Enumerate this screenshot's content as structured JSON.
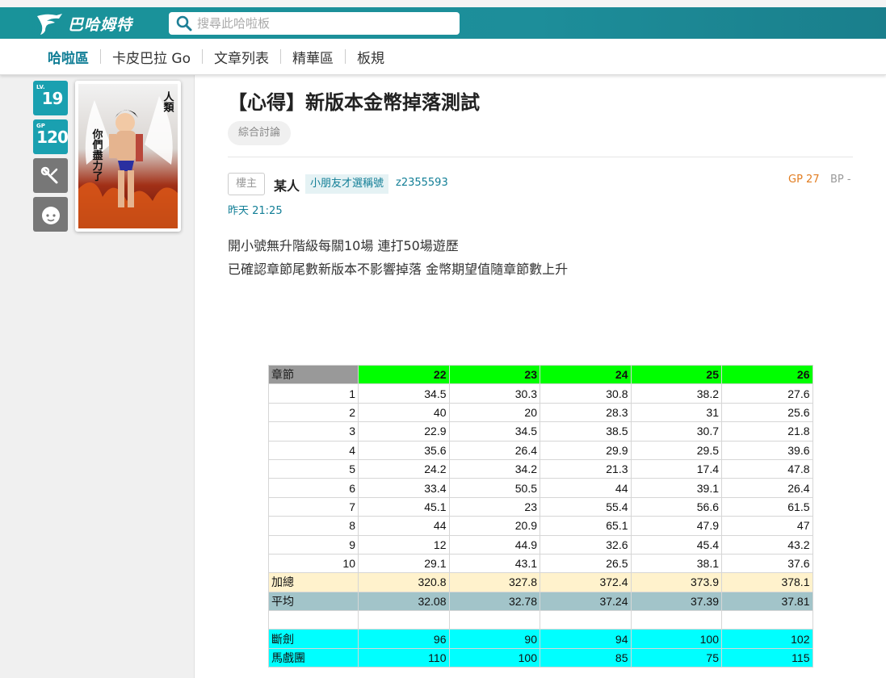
{
  "site": {
    "logo_text": "巴哈姆特"
  },
  "search": {
    "placeholder": "搜尋此哈啦板"
  },
  "nav": {
    "items": [
      {
        "label": "哈啦區",
        "active": true
      },
      {
        "label": "卡皮巴拉 Go",
        "active": false
      },
      {
        "label": "文章列表",
        "active": false
      },
      {
        "label": "精華區",
        "active": false
      },
      {
        "label": "板規",
        "active": false
      }
    ]
  },
  "user_panel": {
    "level_prefix": "LV.",
    "level": "19",
    "gp_prefix": "GP",
    "gp": "120",
    "tool_icon": "wrench-icon",
    "face_icon": "face-icon",
    "avatar_text": [
      "人類",
      "你們盡力了"
    ]
  },
  "post": {
    "title": "【心得】新版本金幣掉落測試",
    "tag": "綜合討論",
    "floor": "樓主",
    "author": "某人",
    "author_title": "小朋友才選稱號",
    "author_id": "z2355593",
    "gp": "GP 27",
    "bp": "BP -",
    "time": "昨天 21:25",
    "lines": [
      "開小號無升階級每關10場 連打50場遊歷",
      "已確認章節尾數新版本不影響掉落 金幣期望值隨章節數上升"
    ]
  },
  "table": {
    "header_label": "章節",
    "columns": [
      "22",
      "23",
      "24",
      "25",
      "26"
    ],
    "rows": [
      {
        "label": "1",
        "values": [
          "34.5",
          "30.3",
          "30.8",
          "38.2",
          "27.6"
        ]
      },
      {
        "label": "2",
        "values": [
          "40",
          "20",
          "28.3",
          "31",
          "25.6"
        ]
      },
      {
        "label": "3",
        "values": [
          "22.9",
          "34.5",
          "38.5",
          "30.7",
          "21.8"
        ]
      },
      {
        "label": "4",
        "values": [
          "35.6",
          "26.4",
          "29.9",
          "29.5",
          "39.6"
        ]
      },
      {
        "label": "5",
        "values": [
          "24.2",
          "34.2",
          "21.3",
          "17.4",
          "47.8"
        ]
      },
      {
        "label": "6",
        "values": [
          "33.4",
          "50.5",
          "44",
          "39.1",
          "26.4"
        ]
      },
      {
        "label": "7",
        "values": [
          "45.1",
          "23",
          "55.4",
          "56.6",
          "61.5"
        ]
      },
      {
        "label": "8",
        "values": [
          "44",
          "20.9",
          "65.1",
          "47.9",
          "47"
        ]
      },
      {
        "label": "9",
        "values": [
          "12",
          "44.9",
          "32.6",
          "45.4",
          "43.2"
        ]
      },
      {
        "label": "10",
        "values": [
          "29.1",
          "43.1",
          "26.5",
          "38.1",
          "37.6"
        ]
      }
    ],
    "sum": {
      "label": "加總",
      "values": [
        "320.8",
        "327.8",
        "372.4",
        "373.9",
        "378.1"
      ]
    },
    "avg": {
      "label": "平均",
      "values": [
        "32.08",
        "32.78",
        "37.24",
        "37.39",
        "37.81"
      ]
    },
    "extra": [
      {
        "label": "斷劍",
        "values": [
          "96",
          "90",
          "94",
          "100",
          "102"
        ]
      },
      {
        "label": "馬戲團",
        "values": [
          "110",
          "100",
          "85",
          "75",
          "115"
        ]
      }
    ]
  }
}
